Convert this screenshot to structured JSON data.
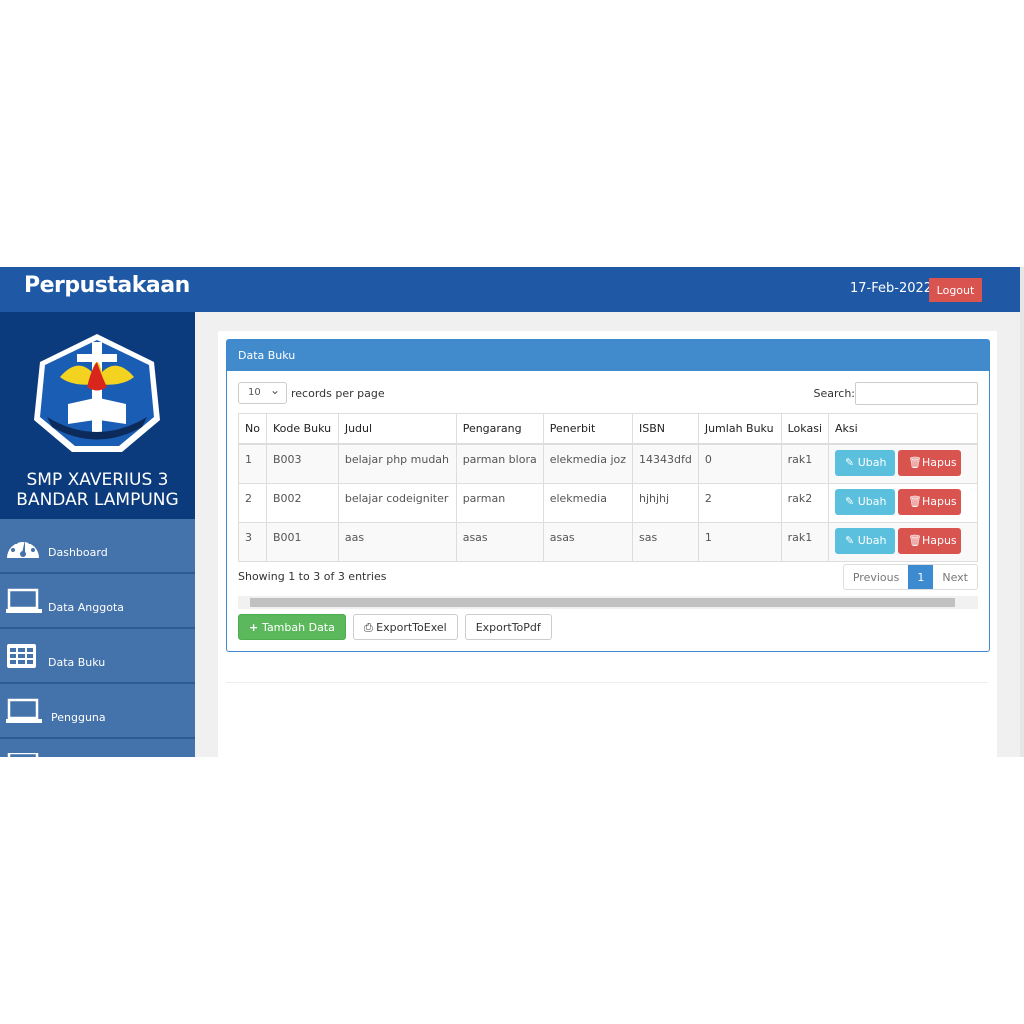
{
  "header": {
    "title": "Perpustakaan",
    "date": "17-Feb-2022",
    "logout": "Logout"
  },
  "sidebar": {
    "school": "SMP XAVERIUS 3 BANDAR LAMPUNG",
    "logo_text": "SMP XAVERIUS 3 BANDAR LAMPUNG",
    "items": [
      {
        "label": "Dashboard",
        "icon": "dashboard-icon"
      },
      {
        "label": "Data Anggota",
        "icon": "laptop-icon"
      },
      {
        "label": "Data Buku",
        "icon": "table-icon"
      },
      {
        "label": "Pengguna",
        "icon": "laptop-icon"
      }
    ]
  },
  "card": {
    "title": "Data Buku",
    "length_value": "10",
    "length_label": "records per page",
    "search_label": "Search:",
    "search_value": "",
    "columns": [
      "No",
      "Kode Buku",
      "Judul",
      "Pengarang",
      "Penerbit",
      "ISBN",
      "Jumlah Buku",
      "Lokasi",
      "Aksi"
    ],
    "rows": [
      [
        "1",
        "B003",
        "belajar php mudah",
        "parman blora",
        "elekmedia joz",
        "14343dfd",
        "0",
        "rak1"
      ],
      [
        "2",
        "B002",
        "belajar codeigniter",
        "parman",
        "elekmedia",
        "hjhjhj",
        "2",
        "rak2"
      ],
      [
        "3",
        "B001",
        "aas",
        "asas",
        "asas",
        "sas",
        "1",
        "rak1"
      ]
    ],
    "edit_label": "Ubah",
    "delete_label": "Hapus",
    "info": "Showing 1 to 3 of 3 entries",
    "pager": {
      "previous": "Previous",
      "current": "1",
      "next": "Next"
    },
    "buttons": {
      "add": "Tambah Data",
      "excel": "ExportToExel",
      "pdf": "ExportToPdf"
    }
  }
}
